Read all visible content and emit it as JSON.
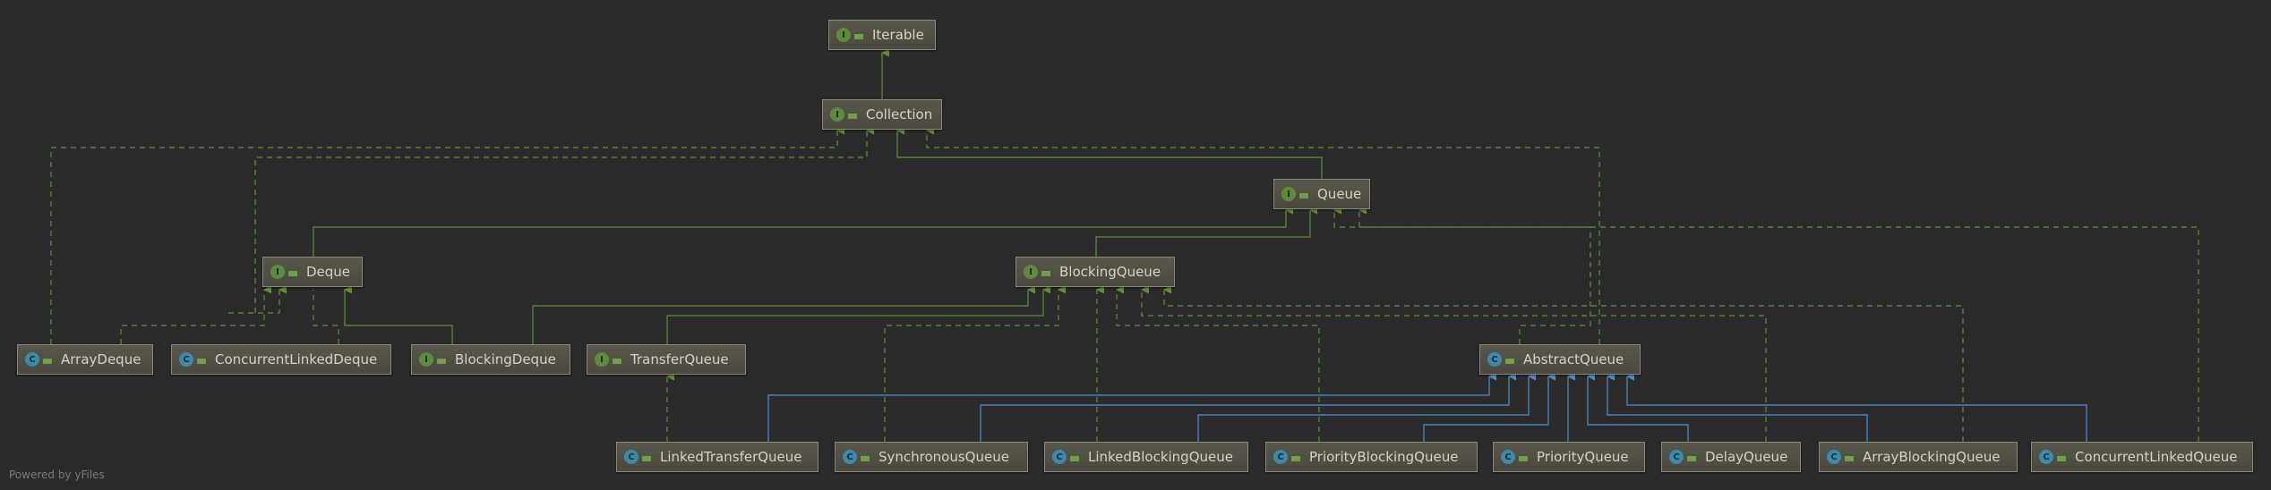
{
  "colors": {
    "background": "#2b2b2b",
    "extends_edge": "#5a9437",
    "implements_edge": "#5a9437",
    "class_extends_edge": "#4f8fd0",
    "interface_badge": "#5f8c3c",
    "class_badge": "#3f89a8"
  },
  "nodes": {
    "iterable": {
      "label": "Iterable",
      "kind": "interface",
      "badge": "I",
      "icon": "interface-icon"
    },
    "collection": {
      "label": "Collection",
      "kind": "interface",
      "badge": "I",
      "icon": "interface-icon"
    },
    "queue": {
      "label": "Queue",
      "kind": "interface",
      "badge": "I",
      "icon": "interface-icon"
    },
    "deque": {
      "label": "Deque",
      "kind": "interface",
      "badge": "I",
      "icon": "interface-icon"
    },
    "blocking_queue": {
      "label": "BlockingQueue",
      "kind": "interface",
      "badge": "I",
      "icon": "interface-icon"
    },
    "array_deque": {
      "label": "ArrayDeque",
      "kind": "class",
      "badge": "C",
      "icon": "class-icon"
    },
    "concurrent_linked_deque": {
      "label": "ConcurrentLinkedDeque",
      "kind": "class",
      "badge": "C",
      "icon": "class-icon"
    },
    "blocking_deque": {
      "label": "BlockingDeque",
      "kind": "interface",
      "badge": "I",
      "icon": "interface-icon"
    },
    "transfer_queue": {
      "label": "TransferQueue",
      "kind": "interface",
      "badge": "I",
      "icon": "interface-icon"
    },
    "abstract_queue": {
      "label": "AbstractQueue",
      "kind": "abstract-class",
      "badge": "C",
      "icon": "abstract-class-icon"
    },
    "linked_transfer_queue": {
      "label": "LinkedTransferQueue",
      "kind": "class",
      "badge": "C",
      "icon": "class-icon"
    },
    "synchronous_queue": {
      "label": "SynchronousQueue",
      "kind": "class",
      "badge": "C",
      "icon": "class-icon"
    },
    "linked_blocking_queue": {
      "label": "LinkedBlockingQueue",
      "kind": "class",
      "badge": "C",
      "icon": "class-icon"
    },
    "priority_blocking_queue": {
      "label": "PriorityBlockingQueue",
      "kind": "class",
      "badge": "C",
      "icon": "class-icon"
    },
    "priority_queue": {
      "label": "PriorityQueue",
      "kind": "class",
      "badge": "C",
      "icon": "class-icon"
    },
    "delay_queue": {
      "label": "DelayQueue",
      "kind": "class",
      "badge": "C",
      "icon": "class-icon"
    },
    "array_blocking_queue": {
      "label": "ArrayBlockingQueue",
      "kind": "class",
      "badge": "C",
      "icon": "class-icon"
    },
    "concurrent_linked_queue": {
      "label": "ConcurrentLinkedQueue",
      "kind": "class",
      "badge": "C",
      "icon": "class-icon"
    }
  },
  "footer": {
    "credit": "Powered by yFiles"
  }
}
